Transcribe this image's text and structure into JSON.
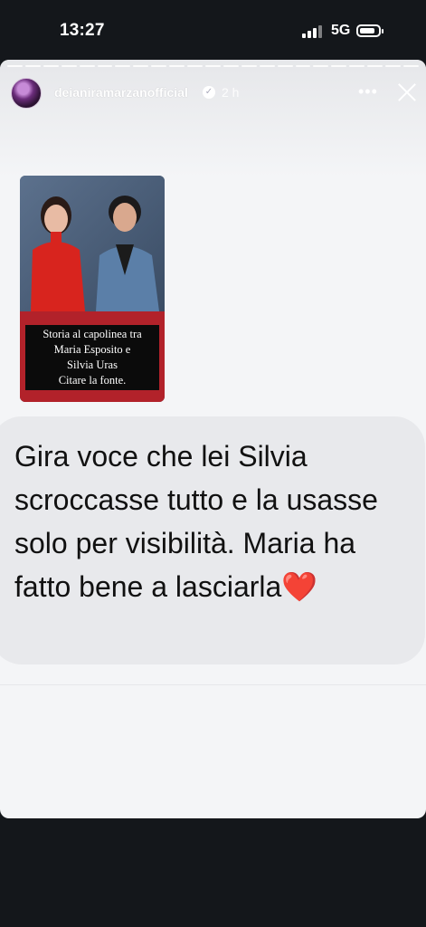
{
  "status_bar": {
    "time": "13:27",
    "network": "5G"
  },
  "story": {
    "username": "deianiramarzanofficial",
    "time_ago": "2 h",
    "shared_post": {
      "caption_lines": [
        "Storia al capolinea tra",
        "Maria Esposito e",
        "Silvia Uras",
        "Citare la fonte."
      ]
    },
    "question_text": "Gira voce che lei Silvia scroccasse tutto e la usasse solo per visibilità. Maria ha fatto bene a lasciarla",
    "question_emoji": "❤️"
  },
  "colors": {
    "background": "#14171b",
    "card": "#f4f5f7",
    "bubble": "#e8e9ec",
    "accent_red": "#b2222a"
  }
}
